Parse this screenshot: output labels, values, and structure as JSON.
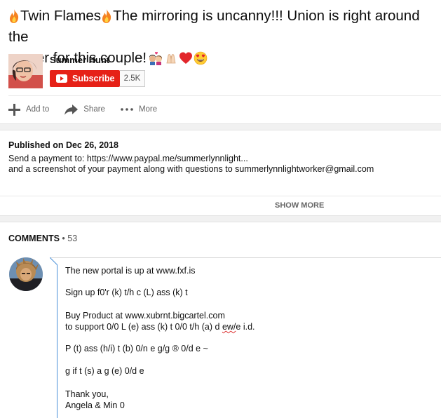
{
  "video": {
    "title_line1": "Twin Flames",
    "title_line1b": "The mirroring is uncanny!!! Union is right around the",
    "title_line2": "corner for this couple!"
  },
  "channel": {
    "name": "Summer Hunt",
    "subscribe_label": "Subscribe",
    "subscriber_count": "2.5K"
  },
  "actions": {
    "add_to": "Add to",
    "share": "Share",
    "more": "More"
  },
  "description": {
    "published": "Published on Dec 26, 2018",
    "line1": "Send a payment to: https://www.paypal.me/summerlynnlight...",
    "line2": "and a screenshot of your payment along with questions to summerlynnlightworker@gmail.com",
    "show_more": "SHOW MORE"
  },
  "comments": {
    "label": "COMMENTS",
    "separator": " • ",
    "count": "53",
    "draft": {
      "l1": "The new portal is up at www.fxf.is",
      "l2": "Sign up f0'r (k) t/h c (L) ass (k) t",
      "l3": "Buy Product at www.xubrnt.bigcartel.com",
      "l4a": "to support 0/0 L (e) ass (k) t 0/0 t/h (a) d ",
      "l4b": "ew/",
      "l4c": "e i.d.",
      "l5": "P (t) ass (h/i) t (b) 0/n e g/g ® 0/d e ~",
      "l6": "g if t (s) a g (e) 0/d e",
      "l7": "Thank you,",
      "l8": "Angela & Min 0"
    }
  },
  "colors": {
    "subscribe_red": "#e62117",
    "focus_blue": "#4a90d9",
    "muted_text": "#666666"
  },
  "icons": [
    "fire-icon",
    "couple-kiss-icon",
    "folded-hands-icon",
    "red-heart-icon",
    "heart-eyes-icon",
    "youtube-play-icon",
    "plus-icon",
    "share-arrow-icon",
    "more-dots-icon"
  ]
}
